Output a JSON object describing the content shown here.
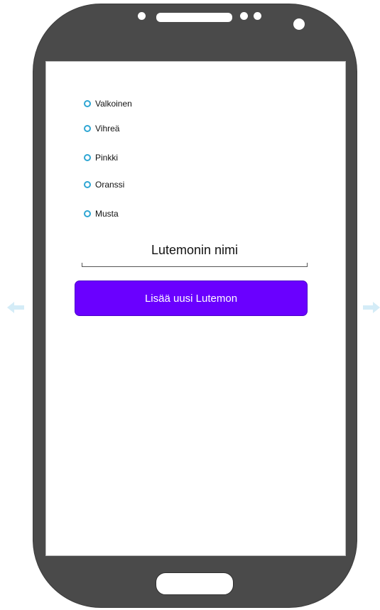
{
  "colors": {
    "phone_body": "#4a4a4a",
    "radio_accent": "#2fa6d3",
    "button_bg": "#6a00ff",
    "button_text": "#ffffff",
    "arrow": "#d4ecf7"
  },
  "icons": {
    "prev": "arrow-left-icon",
    "next": "arrow-right-icon"
  },
  "color_options": [
    {
      "label": "Valkoinen"
    },
    {
      "label": "Vihreä"
    },
    {
      "label": "Pinkki"
    },
    {
      "label": "Oranssi"
    },
    {
      "label": "Musta"
    }
  ],
  "name_field": {
    "value": "Lutemonin nimi"
  },
  "add_button": {
    "label": "Lisää uusi Lutemon"
  }
}
